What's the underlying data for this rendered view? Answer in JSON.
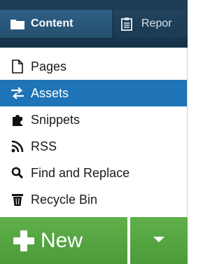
{
  "tabs": {
    "content": {
      "label": "Content",
      "icon": "folder-icon"
    },
    "reports": {
      "label": "Repor",
      "icon": "clipboard-icon"
    }
  },
  "menu": {
    "items": [
      {
        "label": "Pages",
        "icon": "page-icon",
        "active": false
      },
      {
        "label": "Assets",
        "icon": "swap-arrows-icon",
        "active": true
      },
      {
        "label": "Snippets",
        "icon": "puzzle-icon",
        "active": false
      },
      {
        "label": "RSS",
        "icon": "rss-icon",
        "active": false
      },
      {
        "label": "Find and Replace",
        "icon": "search-icon",
        "active": false
      },
      {
        "label": "Recycle Bin",
        "icon": "trash-icon",
        "active": false
      }
    ]
  },
  "footer": {
    "new_label": "New",
    "new_icon": "plus-icon",
    "dropdown_icon": "caret-down-icon"
  },
  "colors": {
    "topbar": "#1c3a53",
    "active_tab": "#2b5a7f",
    "active_item": "#1e74b6",
    "new_button": "#55a542"
  }
}
